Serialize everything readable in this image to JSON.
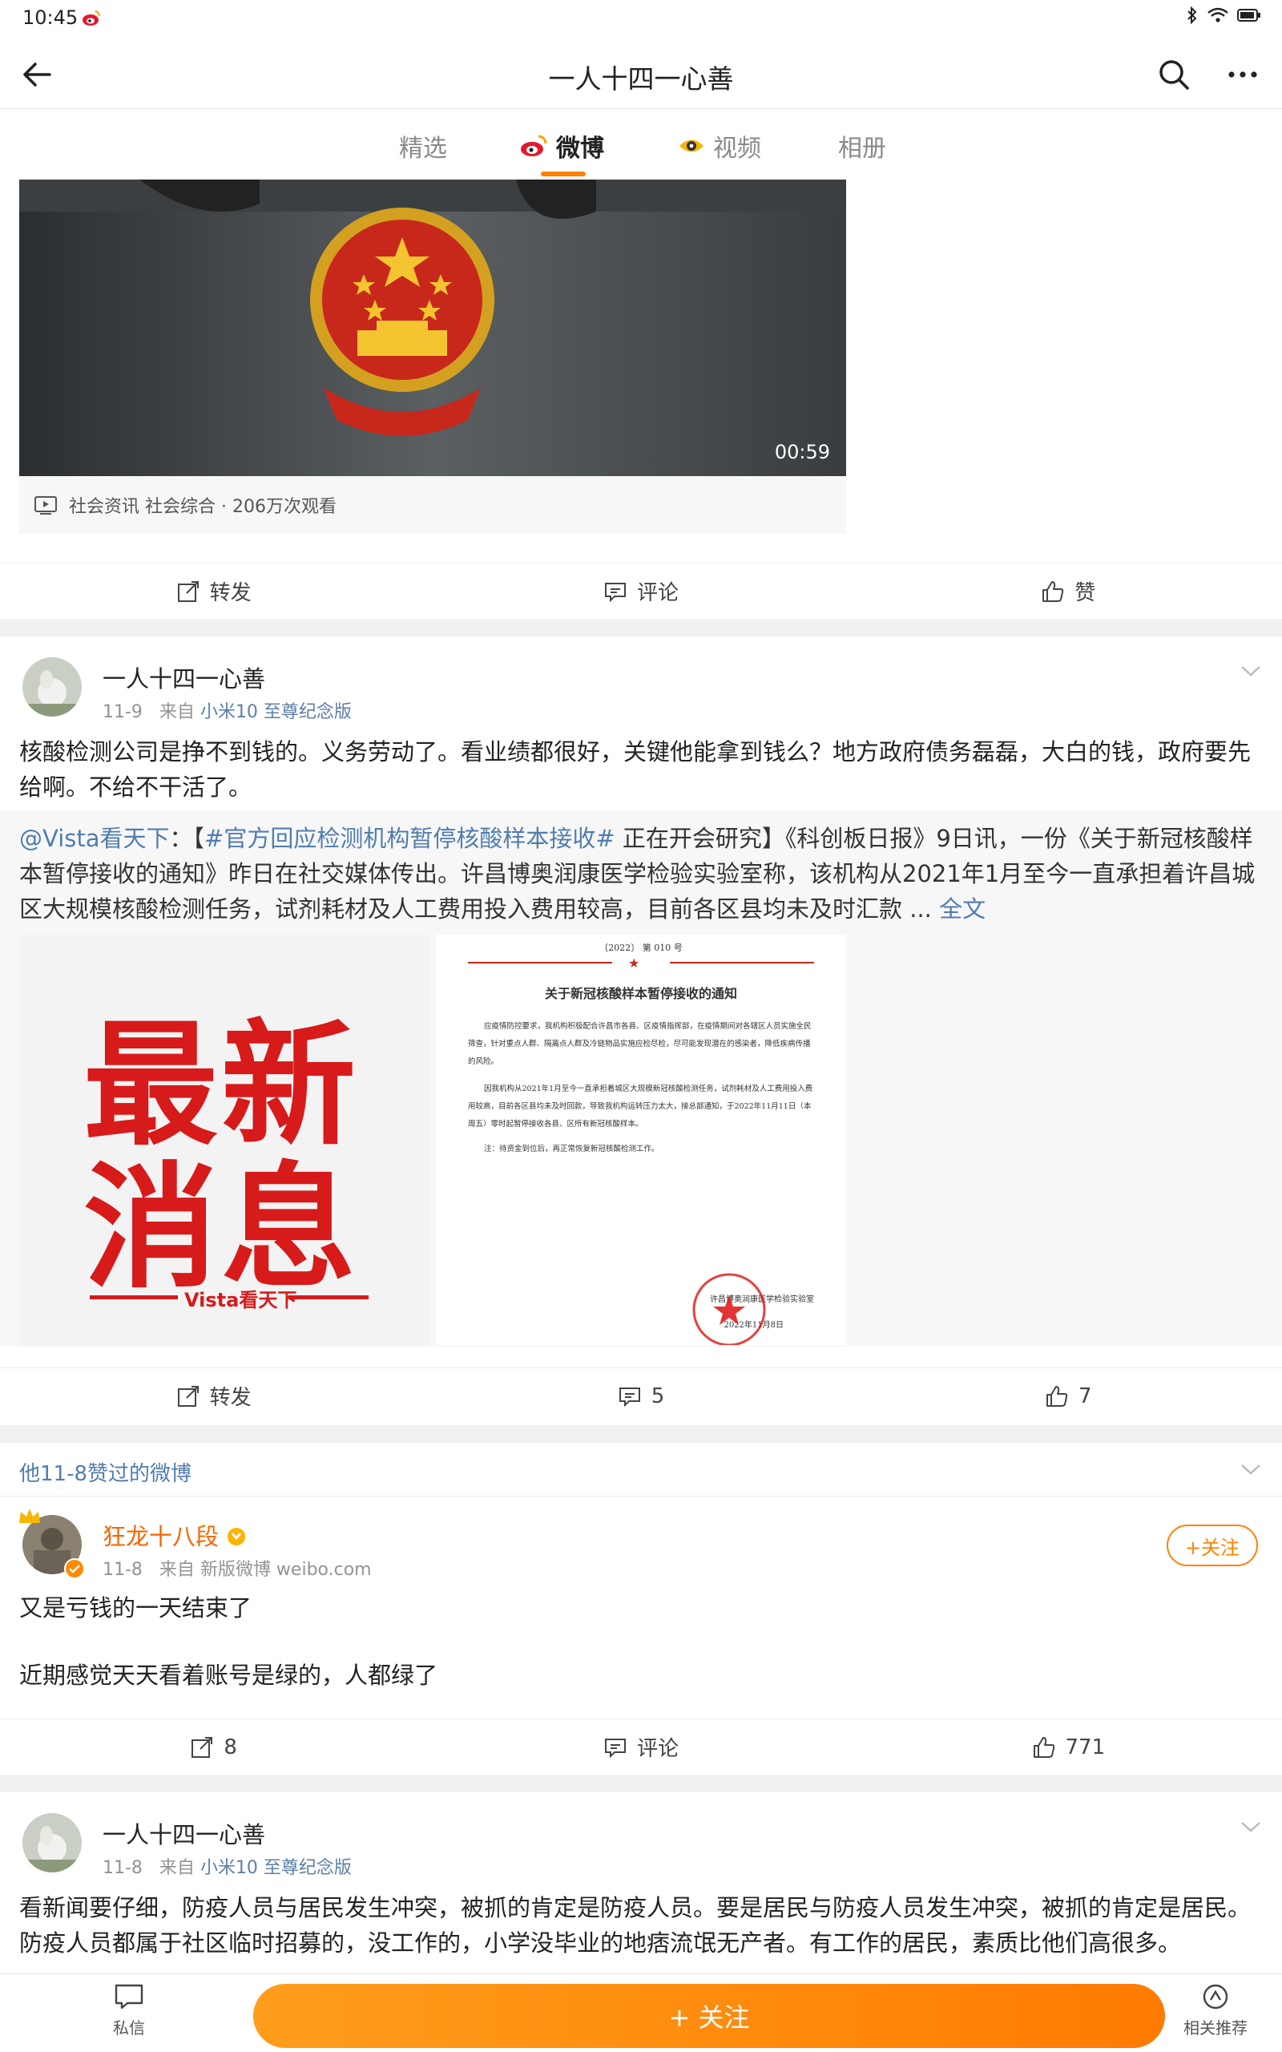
{
  "status": {
    "time": "10:45"
  },
  "nav": {
    "title": "一人十四一心善"
  },
  "tabs": [
    {
      "label": "精选"
    },
    {
      "label": "微博"
    },
    {
      "label": "视频"
    },
    {
      "label": "相册"
    }
  ],
  "post1": {
    "video_duration": "00:59",
    "video_meta": "社会资讯 社会综合 · 206万次观看",
    "actions": {
      "repost": "转发",
      "comment": "评论",
      "like": "赞"
    }
  },
  "post2": {
    "username": "一人十四一心善",
    "date": "11-9",
    "from_prefix": "来自",
    "source": "小米10 至尊纪念版",
    "text": "核酸检测公司是挣不到钱的。义务劳动了。看业绩都很好，关键他能拿到钱么？地方政府债务磊磊，大白的钱，政府要先给啊。不给不干活了。",
    "repost": {
      "author": "@Vista看天下",
      "sep": "：【",
      "topic": "#官方回应检测机构暂停核酸样本接收#",
      "text": " 正在开会研究】《科创板日报》9日讯，一份《关于新冠核酸样本暂停接收的通知》昨日在社交媒体传出。许昌博奥润康医学检验实验室称，该机构从2021年1月至今一直承担着许昌城区大规模核酸检测任务，试剂耗材及人工费用投入费用较高，目前各区县均未及时汇款 ... ",
      "full_text_link": "全文",
      "image1_text_line1": "最新",
      "image1_text_line2": "消息",
      "image1_brand": "Vista看天下",
      "doc_header": "〔2022〕 第 010 号",
      "doc_title": "关于新冠核酸样本暂停接收的通知",
      "doc_para1": "应疫情防控要求，我机构积极配合许昌市各县、区疫情指挥部，在疫情期间对各辖区人员实施全民筛查，针对重点人群、隔离点人群及冷链物品实施应检尽检，尽可能发现潜在的感染者，降低疾病传播的风险。",
      "doc_para2": "因我机构从2021年1月至今一直承担着城区大规模新冠核酸检测任务，试剂耗材及人工费用投入费用较高，目前各区县均未及时回款，导致我机构运转压力太大，接总部通知，于2022年11月11日（本周五）零时起暂停接收各县、区所有新冠核酸样本。",
      "doc_note": "注：待资金到位后，再正常恢复新冠核酸检测工作。",
      "doc_sign": "许昌博奥润康医学检验实验室",
      "doc_date": "2022年11月8日"
    },
    "actions": {
      "repost": "转发",
      "comment": "5",
      "like": "7"
    }
  },
  "liked_section": {
    "header": "他11-8赞过的微博"
  },
  "post3": {
    "username": "狂龙十八段",
    "date": "11-8",
    "from_prefix": "来自",
    "source": "新版微博 weibo.com",
    "follow": "+关注",
    "text_line1": "又是亏钱的一天结束了",
    "text_line2": "近期感觉天天看着账号是绿的，人都绿了",
    "actions": {
      "repost": "8",
      "comment": "评论",
      "like": "771"
    }
  },
  "post4": {
    "username": "一人十四一心善",
    "date": "11-8",
    "from_prefix": "来自",
    "source": "小米10 至尊纪念版",
    "text": "看新闻要仔细，防疫人员与居民发生冲突，被抓的肯定是防疫人员。要是居民与防疫人员发生冲突，被抓的肯定是居民。防疫人员都属于社区临时招募的，没工作的，小学没毕业的地痞流氓无产者。有工作的居民，素质比他们高很多。"
  },
  "bottom": {
    "message": "私信",
    "follow": "+ 关注",
    "related": "相关推荐"
  },
  "colors": {
    "accent": "#ff8200",
    "link": "#507daf"
  }
}
